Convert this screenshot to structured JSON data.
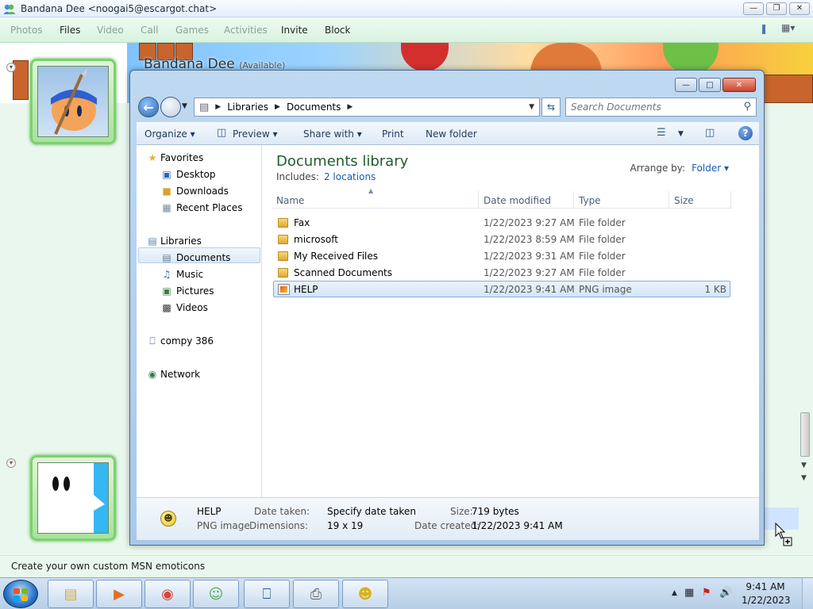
{
  "msn": {
    "title": "Bandana Dee <noogai5@escargot.chat>",
    "menu": [
      {
        "label": "Photos",
        "enabled": false
      },
      {
        "label": "Files",
        "enabled": true
      },
      {
        "label": "Video",
        "enabled": false
      },
      {
        "label": "Call",
        "enabled": false
      },
      {
        "label": "Games",
        "enabled": false
      },
      {
        "label": "Activities",
        "enabled": false
      },
      {
        "label": "Invite",
        "enabled": true
      },
      {
        "label": "Block",
        "enabled": true
      }
    ],
    "contact_name": "Bandana Dee",
    "contact_status": "(Available)",
    "status_bar": "Create your own custom MSN emoticons"
  },
  "explorer": {
    "breadcrumb": [
      "Libraries",
      "Documents"
    ],
    "search_placeholder": "Search Documents",
    "toolbar": {
      "organize": "Organize",
      "preview": "Preview",
      "share_with": "Share with",
      "print": "Print",
      "new_folder": "New folder"
    },
    "nav": {
      "favorites": "Favorites",
      "desktop": "Desktop",
      "downloads": "Downloads",
      "recent_places": "Recent Places",
      "libraries": "Libraries",
      "documents": "Documents",
      "music": "Music",
      "pictures": "Pictures",
      "videos": "Videos",
      "computer": "compy 386",
      "network": "Network"
    },
    "library_title": "Documents library",
    "includes_label": "Includes:",
    "includes_link": "2 locations",
    "arrange_label": "Arrange by:",
    "arrange_value": "Folder",
    "columns": {
      "name": "Name",
      "date": "Date modified",
      "type": "Type",
      "size": "Size"
    },
    "files": [
      {
        "name": "Fax",
        "date": "1/22/2023 9:27 AM",
        "type": "File folder",
        "size": "",
        "kind": "folder"
      },
      {
        "name": "microsoft",
        "date": "1/22/2023 8:59 AM",
        "type": "File folder",
        "size": "",
        "kind": "folder"
      },
      {
        "name": "My Received Files",
        "date": "1/22/2023 9:31 AM",
        "type": "File folder",
        "size": "",
        "kind": "folder"
      },
      {
        "name": "Scanned Documents",
        "date": "1/22/2023 9:27 AM",
        "type": "File folder",
        "size": "",
        "kind": "folder"
      },
      {
        "name": "HELP",
        "date": "1/22/2023 9:41 AM",
        "type": "PNG image",
        "size": "1 KB",
        "kind": "png",
        "selected": true
      }
    ],
    "details": {
      "name": "HELP",
      "type": "PNG image",
      "date_taken_label": "Date taken:",
      "date_taken": "Specify date taken",
      "dimensions_label": "Dimensions:",
      "dimensions": "19 x 19",
      "size_label": "Size:",
      "size": "719 bytes",
      "date_created_label": "Date created:",
      "date_created": "1/22/2023 9:41 AM"
    }
  },
  "taskbar": {
    "time": "9:41 AM",
    "date": "1/22/2023",
    "pinned": [
      "folder-icon",
      "media-player-icon",
      "chrome-icon",
      "msn-messenger-icon",
      "remote-desktop-icon",
      "fax-scan-icon",
      "emoticon-icon"
    ]
  },
  "colors": {
    "library_title": "#1e5d2a",
    "link": "#1a5bb5",
    "msn_bg": "#eaf7ee"
  }
}
